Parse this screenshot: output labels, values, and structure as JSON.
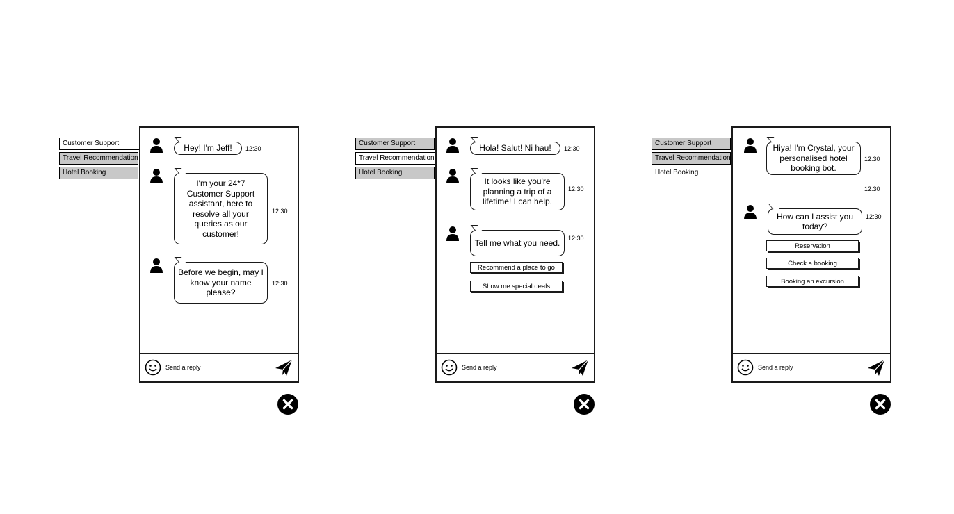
{
  "tabs": [
    "Customer Support",
    "Travel Recommendation",
    "Hotel Booking"
  ],
  "composer": {
    "placeholder": "Send a reply"
  },
  "panels": [
    {
      "active_tab": "Customer Support",
      "messages": [
        {
          "text": "Hey! I'm Jeff!",
          "time": "12:30"
        },
        {
          "text": "I'm your 24*7 Customer Support assistant, here to resolve all your queries as our customer!",
          "time": "12:30"
        },
        {
          "text": "Before we begin, may I know your name please?",
          "time": "12:30"
        }
      ]
    },
    {
      "active_tab": "Travel Recommendation",
      "messages": [
        {
          "text": "Hola! Salut! Ni hau!",
          "time": "12:30"
        },
        {
          "text": "It looks like you're planning a trip of a lifetime!  I can help.",
          "time": "12:30"
        },
        {
          "text": "Tell me what you need.",
          "time": "12:30"
        }
      ],
      "quick_replies": [
        "Recommend a place to go",
        "Show me special deals"
      ]
    },
    {
      "active_tab": "Hotel Booking",
      "messages": [
        {
          "text": "Hiya! I'm Crystal, your personalised hotel booking bot.",
          "time": "12:30"
        },
        {
          "text": "How can I assist you today?",
          "time": "12:30"
        }
      ],
      "extra_time": "12:30",
      "quick_replies": [
        "Reservation",
        "Check a booking",
        "Booking an excursion"
      ]
    }
  ]
}
